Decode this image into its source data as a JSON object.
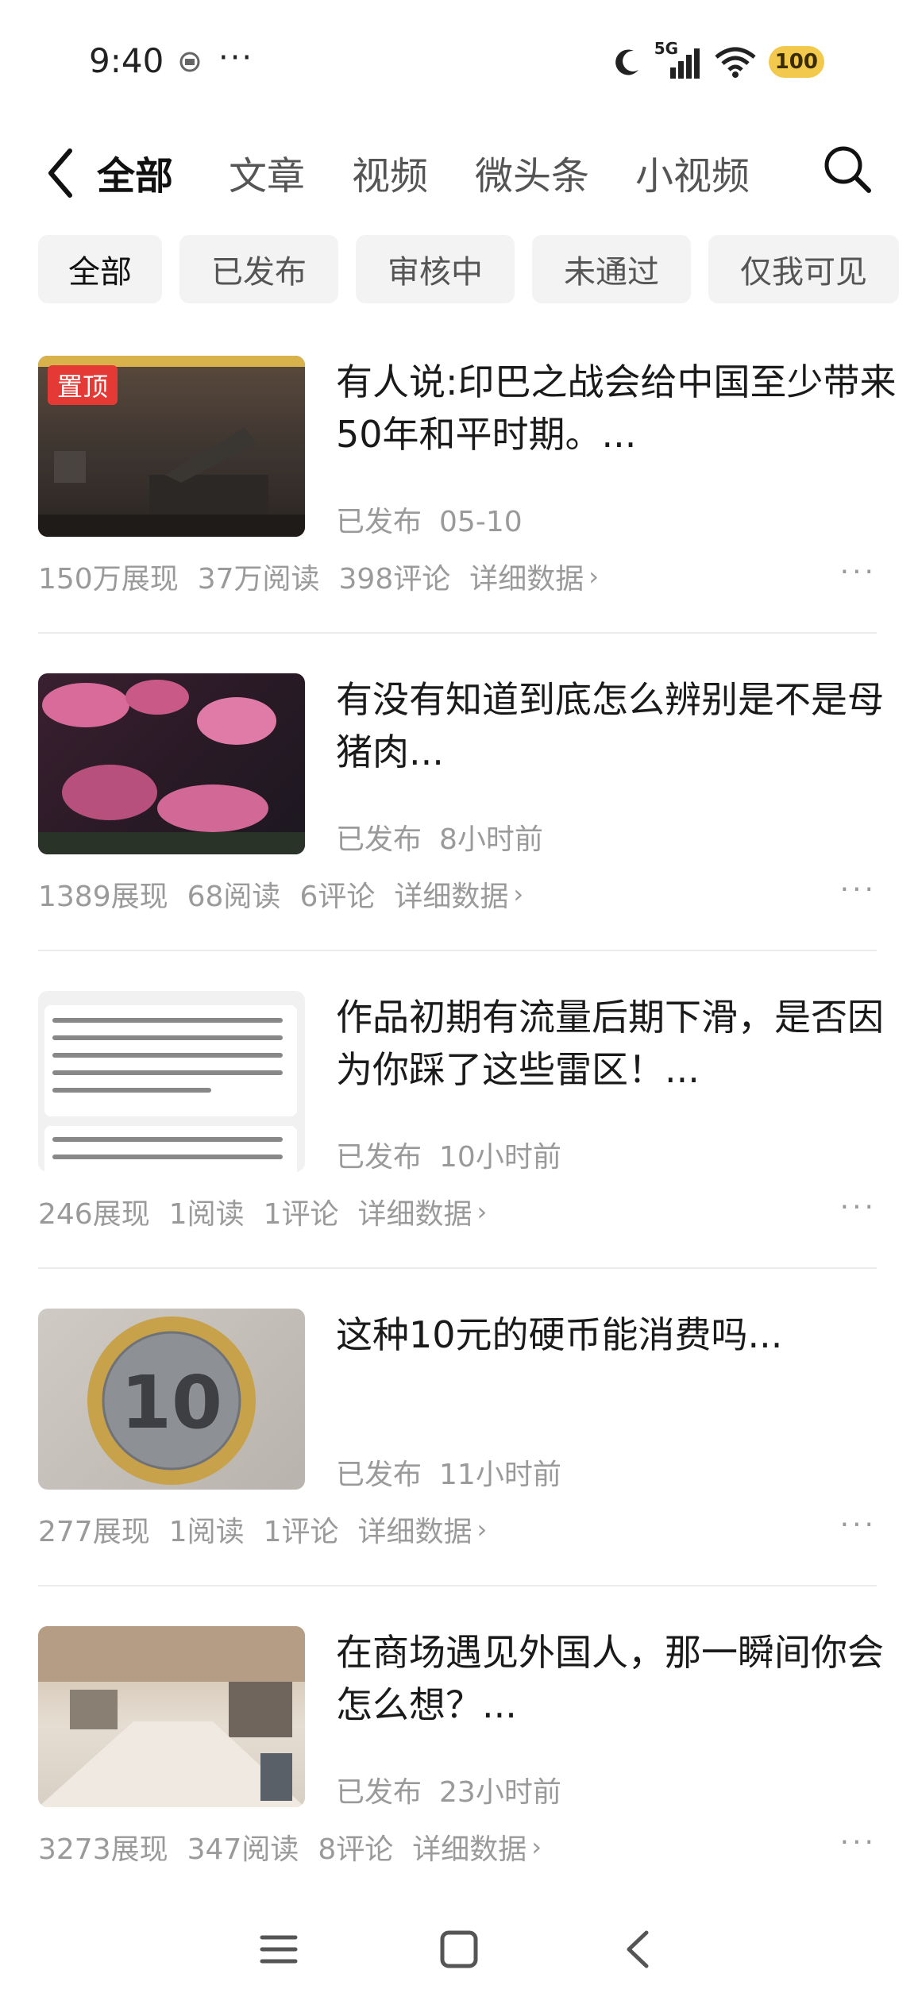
{
  "status_bar": {
    "time": "9:40",
    "dots": "···",
    "network": "5G",
    "battery": "100",
    "icons": [
      "moon-icon",
      "signal-icon",
      "wifi-icon",
      "battery-icon"
    ]
  },
  "tabs": [
    {
      "label": "全部",
      "active": true
    },
    {
      "label": "文章",
      "active": false
    },
    {
      "label": "视频",
      "active": false
    },
    {
      "label": "微头条",
      "active": false
    },
    {
      "label": "小视频",
      "active": false
    }
  ],
  "filters": [
    {
      "label": "全部",
      "active": true
    },
    {
      "label": "已发布",
      "active": false
    },
    {
      "label": "审核中",
      "active": false
    },
    {
      "label": "未通过",
      "active": false
    },
    {
      "label": "仅我可见",
      "active": false
    }
  ],
  "items": [
    {
      "title": "有人说:印巴之战会给中国至少带来50年和平时期。...",
      "pinned_label": "置顶",
      "status": "已发布",
      "time": "05-10",
      "impressions": "150万展现",
      "reads": "37万阅读",
      "comments": "398评论",
      "detail_link": "详细数据"
    },
    {
      "title": "有没有知道到底怎么辨别是不是母猪肉...",
      "status": "已发布",
      "time": "8小时前",
      "impressions": "1389展现",
      "reads": "68阅读",
      "comments": "6评论",
      "detail_link": "详细数据"
    },
    {
      "title": "作品初期有流量后期下滑，是否因为你踩了这些雷区！...",
      "status": "已发布",
      "time": "10小时前",
      "impressions": "246展现",
      "reads": "1阅读",
      "comments": "1评论",
      "detail_link": "详细数据"
    },
    {
      "title": "这种10元的硬币能消费吗...",
      "status": "已发布",
      "time": "11小时前",
      "impressions": "277展现",
      "reads": "1阅读",
      "comments": "1评论",
      "detail_link": "详细数据"
    },
    {
      "title": "在商场遇见外国人，那一瞬间你会怎么想？...",
      "status": "已发布",
      "time": "23小时前",
      "impressions": "3273展现",
      "reads": "347阅读",
      "comments": "8评论",
      "detail_link": "详细数据"
    }
  ],
  "ui": {
    "chevron": "›",
    "more_dots": "···"
  },
  "colors": {
    "accent_red": "#e53935",
    "battery_yellow": "#f2c94c",
    "chip_bg": "#f3f3f3",
    "muted_text": "#9a9a9a"
  }
}
